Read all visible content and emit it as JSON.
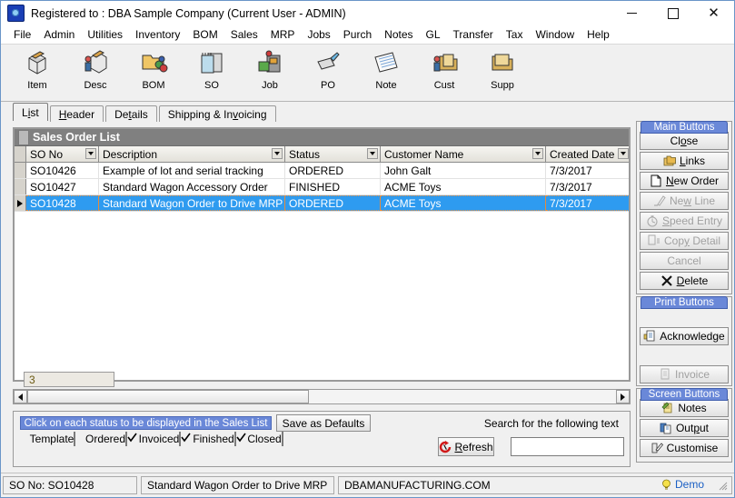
{
  "window": {
    "title": "Registered to : DBA Sample Company (Current User - ADMIN)",
    "app_icon": "dba-app-icon",
    "controls": {
      "minimize": "–",
      "maximize": "□",
      "close": "✕"
    }
  },
  "menubar": {
    "items": [
      "File",
      "Admin",
      "Utilities",
      "Inventory",
      "BOM",
      "Sales",
      "MRP",
      "Jobs",
      "Purch",
      "Notes",
      "GL",
      "Transfer",
      "Tax",
      "Window",
      "Help"
    ]
  },
  "toolbar": {
    "items": [
      {
        "label": "Item",
        "icon": "item-box-icon"
      },
      {
        "label": "Desc",
        "icon": "descriptor-person-box-icon"
      },
      {
        "label": "BOM",
        "icon": "bom-folder-icon"
      },
      {
        "label": "SO",
        "icon": "sales-order-notepad-icon"
      },
      {
        "label": "Job",
        "icon": "job-machine-icon"
      },
      {
        "label": "PO",
        "icon": "purchase-order-icon"
      },
      {
        "label": "Note",
        "icon": "note-pad-icon"
      },
      {
        "label": "Cust",
        "icon": "customer-folder-icon"
      },
      {
        "label": "Supp",
        "icon": "supplier-folder-icon"
      }
    ]
  },
  "tabs": [
    {
      "label": "List",
      "mnemonic": "i",
      "active": true
    },
    {
      "label": "Header",
      "mnemonic": "H",
      "active": false
    },
    {
      "label": "Details",
      "mnemonic": "t",
      "active": false
    },
    {
      "label": "Shipping & Invoicing",
      "mnemonic": "v",
      "active": false
    }
  ],
  "groupbox": {
    "title": "Sales Order List"
  },
  "grid": {
    "columns": [
      {
        "key": "so_no",
        "label": "SO No",
        "filter": true
      },
      {
        "key": "description",
        "label": "Description",
        "filter": true
      },
      {
        "key": "status",
        "label": "Status",
        "filter": true
      },
      {
        "key": "customer_name",
        "label": "Customer Name",
        "filter": true
      },
      {
        "key": "created_date",
        "label": "Created Date",
        "filter": true
      }
    ],
    "rows": [
      {
        "so_no": "SO10426",
        "description": "Example of lot and serial tracking",
        "status": "ORDERED",
        "customer_name": "John Galt",
        "created_date": "7/3/2017",
        "selected": false
      },
      {
        "so_no": "SO10427",
        "description": "Standard Wagon Accessory Order",
        "status": "FINISHED",
        "customer_name": "ACME Toys",
        "created_date": "7/3/2017",
        "selected": false
      },
      {
        "so_no": "SO10428",
        "description": "Standard Wagon Order to Drive MRP",
        "status": "ORDERED",
        "customer_name": "ACME Toys",
        "created_date": "7/3/2017",
        "selected": true
      }
    ],
    "record_count": "3",
    "selected_color": "#2e9bf0"
  },
  "filter_panel": {
    "instruction": "Click on each status to be displayed in the Sales List",
    "save_defaults_label": "Save as Defaults",
    "statuses": [
      {
        "label": "Template",
        "checked": false
      },
      {
        "label": "Ordered",
        "checked": true
      },
      {
        "label": "Invoiced",
        "checked": true
      },
      {
        "label": "Finished",
        "checked": true
      },
      {
        "label": "Closed",
        "checked": false
      }
    ],
    "search_label": "Search for the following text",
    "refresh_label": "Refresh",
    "refresh_mnemonic": "R",
    "search_value": "",
    "search_placeholder": ""
  },
  "side_panels": [
    {
      "header": "Main Buttons",
      "buttons": [
        {
          "label": "Close",
          "mnemonic": "o",
          "icon": "",
          "enabled": true
        },
        {
          "label": "Links",
          "mnemonic": "L",
          "icon": "links-folders-icon",
          "enabled": true
        },
        {
          "label": "New Order",
          "mnemonic": "N",
          "icon": "new-document-icon",
          "enabled": true
        },
        {
          "label": "New Line",
          "mnemonic": "w",
          "icon": "new-line-pen-icon",
          "enabled": false
        },
        {
          "label": "Speed Entry",
          "mnemonic": "S",
          "icon": "speed-entry-clock-icon",
          "enabled": false
        },
        {
          "label": "Copy Detail",
          "mnemonic": "y",
          "icon": "copy-detail-icon",
          "enabled": false
        },
        {
          "label": "Cancel",
          "mnemonic": "",
          "icon": "",
          "enabled": false
        },
        {
          "label": "Delete",
          "mnemonic": "D",
          "icon": "delete-x-icon",
          "enabled": true
        }
      ]
    },
    {
      "header": "Print Buttons",
      "buttons": [
        {
          "label": "Acknowledge",
          "mnemonic": "",
          "icon": "acknowledge-print-icon",
          "enabled": true
        },
        {
          "label": "Invoice",
          "mnemonic": "",
          "icon": "invoice-print-icon",
          "enabled": false
        }
      ]
    },
    {
      "header": "Screen Buttons",
      "buttons": [
        {
          "label": "Notes",
          "mnemonic": "",
          "icon": "notes-pencil-icon",
          "enabled": true
        },
        {
          "label": "Output",
          "mnemonic": "p",
          "icon": "output-copy-icon",
          "enabled": true
        },
        {
          "label": "Customise",
          "mnemonic": "",
          "icon": "customise-brush-icon",
          "enabled": true
        }
      ]
    }
  ],
  "statusbar": {
    "pane1": "SO No: SO10428",
    "pane2": "Standard Wagon Order to Drive MRP",
    "pane3": "DBAMANUFACTURING.COM",
    "demo_label": "Demo",
    "demo_icon": "lightbulb-icon"
  },
  "colors": {
    "accent_blue": "#6a88d8",
    "selection": "#2e9bf0",
    "group_header": "#808080",
    "link_blue": "#1a5fc4"
  }
}
